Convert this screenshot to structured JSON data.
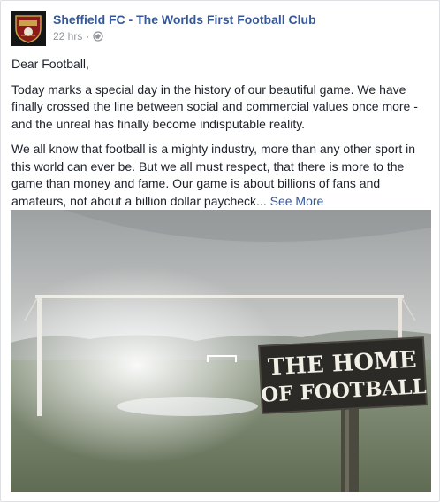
{
  "post": {
    "page_name": "Sheffield FC - The Worlds First Football Club",
    "timestamp": "22 hrs",
    "separator": "·",
    "privacy_icon": "globe-icon",
    "greeting": "Dear Football,",
    "paragraph1": "Today marks a special day in the history of our beautiful game. We have finally crossed the line between social and commercial values once more - and the unreal has finally become indisputable reality.",
    "paragraph2": "We all know that football is a mighty industry, more than any other sport in this world can ever be. But we all must respect, that there is more to the game than money and fame. Our game is about billions of fans and amateurs, not about a billion dollar paycheck...",
    "see_more": "See More",
    "image": {
      "sign_line1": "THE HOME",
      "sign_line2": "OF FOOTBALL"
    }
  },
  "colors": {
    "link": "#365899",
    "text": "#1d2129",
    "muted": "#90949c"
  }
}
